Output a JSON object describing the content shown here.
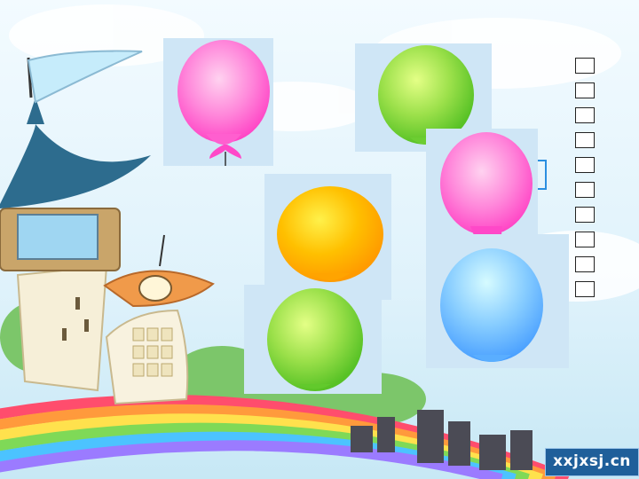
{
  "colors": {
    "sky": "#e6f6fd",
    "balloon_pink": "#ff6fd0",
    "balloon_green": "#7fd63a",
    "balloon_orange": "#ffb300",
    "balloon_blue": "#62b6ff"
  },
  "balloons": [
    {
      "color": "pink"
    },
    {
      "color": "green"
    },
    {
      "color": "pink"
    },
    {
      "color": "orange"
    },
    {
      "color": "green"
    },
    {
      "color": "blue"
    }
  ],
  "answer_boxes_count": 10,
  "watermark": {
    "text": "xxjxsj.cn"
  }
}
